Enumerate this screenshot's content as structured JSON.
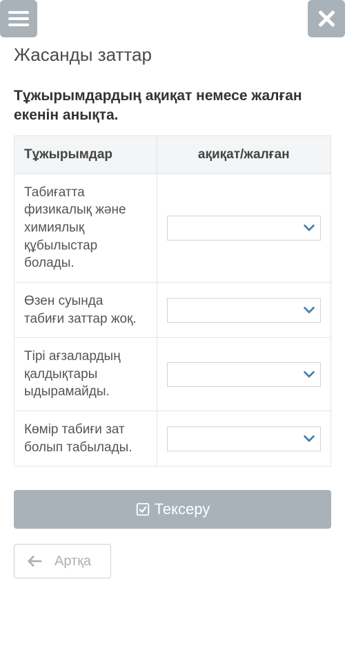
{
  "header": {
    "title": "Жасанды заттар"
  },
  "instruction": "Тұжырымдардың ақиқат немесе жалған екенін анықта.",
  "table": {
    "head": {
      "col1": "Тұжырымдар",
      "col2": "ақиқат/жалған"
    },
    "rows": [
      {
        "statement": "Табиғатта физикалық және химиялық құбылыстар болады.",
        "value": ""
      },
      {
        "statement": "Өзен суында табиғи заттар жоқ.",
        "value": ""
      },
      {
        "statement": "Тірі ағзалардың қалдықтары ыдырамайды.",
        "value": ""
      },
      {
        "statement": "Көмір табиғи зат болып табылады.",
        "value": ""
      }
    ]
  },
  "buttons": {
    "check": "Тексеру",
    "back": "Артқа"
  },
  "icons": {
    "hamburger": "hamburger-icon",
    "close": "close-icon",
    "check": "check-square-icon",
    "back": "arrow-left-icon",
    "caret": "chevron-down-icon"
  }
}
